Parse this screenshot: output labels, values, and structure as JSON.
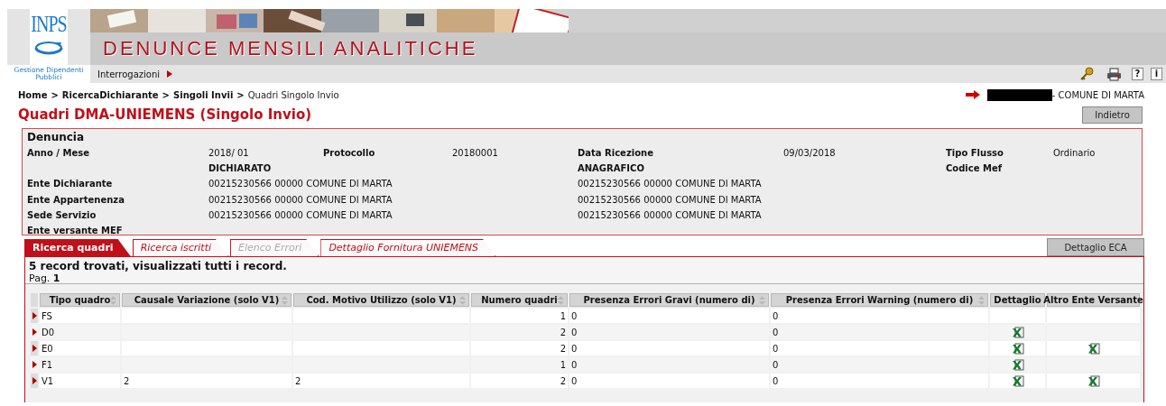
{
  "header": {
    "logo_text": "INPS",
    "org": "Gestione Dipendenti Pubblici",
    "title": "DENUNCE MENSILI ANALITICHE"
  },
  "menu": [
    {
      "label": "Interrogazioni",
      "has_submenu": true
    }
  ],
  "toolbar": [
    {
      "kind": "key"
    },
    {
      "kind": "printer"
    },
    {
      "kind": "text",
      "label": "?"
    },
    {
      "kind": "text",
      "label": "i"
    }
  ],
  "breadcrumb": {
    "links": [
      "Home",
      "RicercaDichiarante",
      "Singoli Invii"
    ],
    "separators": [
      ">",
      ">",
      ">"
    ],
    "current": "Quadri Singolo Invio"
  },
  "user": {
    "redacted": true,
    "text": "- COMUNE DI MARTA"
  },
  "page_title": "Quadri DMA-UNIEMENS (Singolo Invio)",
  "back_button": "Indietro",
  "denuncia": {
    "title": "Denuncia",
    "rows": [
      {
        "kind": "fields",
        "cells": [
          {
            "kind": "label",
            "text": "Anno / Mese"
          },
          {
            "kind": "value",
            "text": "2018/ 01"
          },
          {
            "kind": "label",
            "text": "Protocollo"
          },
          {
            "kind": "value",
            "text": "20180001"
          },
          {
            "kind": "label",
            "text": "Data Ricezione"
          },
          {
            "kind": "value",
            "text": "09/03/2018"
          },
          {
            "kind": "label",
            "text": "Tipo Flusso"
          },
          {
            "kind": "value",
            "text": "Ordinario"
          }
        ]
      },
      {
        "kind": "fields",
        "cells": [
          {
            "kind": "empty"
          },
          {
            "kind": "label",
            "text": "DICHIARATO"
          },
          {
            "kind": "empty"
          },
          {
            "kind": "empty"
          },
          {
            "kind": "label",
            "text": "ANAGRAFICO"
          },
          {
            "kind": "empty"
          },
          {
            "kind": "label",
            "text": "Codice Mef"
          },
          {
            "kind": "empty"
          }
        ]
      },
      {
        "kind": "entity",
        "label": "Ente Dichiarante",
        "dichiarato": "00215230566 00000 COMUNE DI MARTA",
        "anagrafico": "00215230566 00000 COMUNE DI MARTA"
      },
      {
        "kind": "entity",
        "label": "Ente Appartenenza",
        "dichiarato": "00215230566 00000 COMUNE DI MARTA",
        "anagrafico": "00215230566 00000 COMUNE DI MARTA"
      },
      {
        "kind": "entity",
        "label": "Sede Servizio",
        "dichiarato": "00215230566 00000 COMUNE DI MARTA",
        "anagrafico": "00215230566 00000 COMUNE DI MARTA"
      },
      {
        "kind": "entity",
        "label": "Ente versante MEF"
      }
    ]
  },
  "tabs": [
    {
      "label": "Ricerca quadri",
      "selected": true,
      "disabled": false
    },
    {
      "label": "Ricerca iscritti",
      "selected": false,
      "disabled": false
    },
    {
      "label": "Elenco Errori",
      "selected": false,
      "disabled": true
    },
    {
      "label": "Dettaglio Fornitura UNIEMENS",
      "selected": false,
      "disabled": false
    }
  ],
  "eca_button": "Dettaglio ECA",
  "results": {
    "summary": "5 record trovati, visualizzati tutti i record.",
    "page": "Pag. **1**"
  },
  "table": {
    "columns": [
      {
        "label": "Tipo quadro",
        "sortable": true
      },
      {
        "label": "Causale Variazione (solo V1)",
        "sortable": true
      },
      {
        "label": "Cod. Motivo Utilizzo (solo V1)",
        "sortable": true
      },
      {
        "label": "Numero quadri",
        "sortable": true
      },
      {
        "label": "Presenza Errori Gravi (numero di)",
        "sortable": true
      },
      {
        "label": "Presenza Errori Warning (numero di)",
        "sortable": true
      },
      {
        "label": "Dettaglio",
        "sortable": false
      },
      {
        "label": "Altro Ente Versante",
        "sortable": false
      }
    ],
    "rows": [
      {
        "tipo": "FS",
        "causale": "",
        "motivo": "",
        "numero": "1",
        "gravi": "0",
        "warning": "0",
        "dettaglio": false,
        "altro_ente": false
      },
      {
        "tipo": "D0",
        "causale": "",
        "motivo": "",
        "numero": "2",
        "gravi": "0",
        "warning": "0",
        "dettaglio": true,
        "altro_ente": false
      },
      {
        "tipo": "E0",
        "causale": "",
        "motivo": "",
        "numero": "2",
        "gravi": "0",
        "warning": "0",
        "dettaglio": true,
        "altro_ente": true
      },
      {
        "tipo": "F1",
        "causale": "",
        "motivo": "",
        "numero": "1",
        "gravi": "0",
        "warning": "0",
        "dettaglio": true,
        "altro_ente": false
      },
      {
        "tipo": "V1",
        "causale": "2",
        "motivo": "2",
        "numero": "2",
        "gravi": "0",
        "warning": "0",
        "dettaglio": true,
        "altro_ente": true
      }
    ]
  }
}
